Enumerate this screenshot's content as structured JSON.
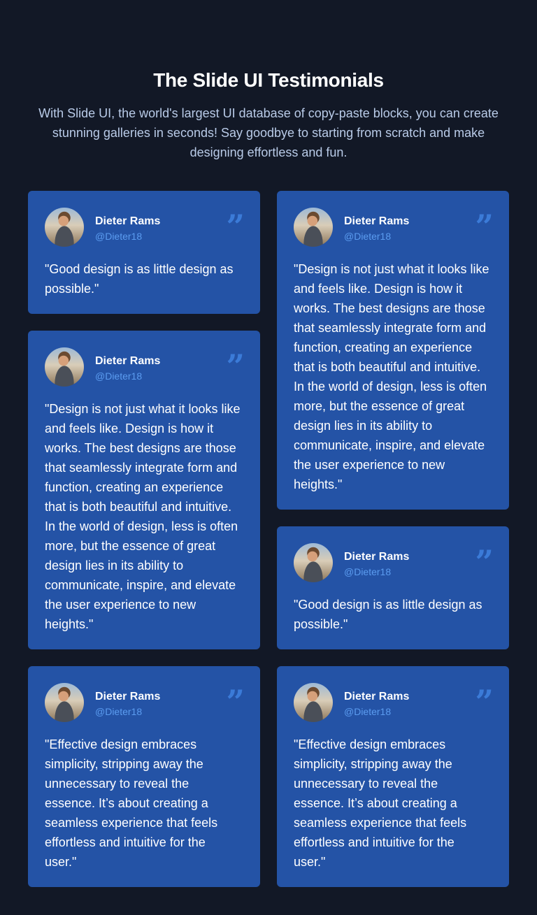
{
  "header": {
    "title": "The Slide UI Testimonials",
    "subtitle": "With Slide UI, the world's largest UI database of copy-paste blocks, you can create stunning galleries in seconds! Say goodbye to starting from scratch and make designing effortless and fun."
  },
  "testimonials": [
    {
      "name": "Dieter Rams",
      "handle": "@Dieter18",
      "quote": "\"Good design is as little design as possible.\""
    },
    {
      "name": "Dieter Rams",
      "handle": "@Dieter18",
      "quote": "\"Design is not just what it looks like and feels like. Design is how it works. The best designs are those that seamlessly integrate form and function, creating an experience that is both beautiful and intuitive. In the world of design, less is often more, but the essence of great design lies in its ability to communicate, inspire, and elevate the user experience to new heights.\""
    },
    {
      "name": "Dieter Rams",
      "handle": "@Dieter18",
      "quote": "\"Design is not just what it looks like and feels like. Design is how it works. The best designs are those that seamlessly integrate form and function, creating an experience that is both beautiful and intuitive. In the world of design, less is often more, but the essence of great design lies in its ability to communicate, inspire, and elevate the user experience to new heights.\""
    },
    {
      "name": "Dieter Rams",
      "handle": "@Dieter18",
      "quote": "\"Good design is as little design as possible.\""
    },
    {
      "name": "Dieter Rams",
      "handle": "@Dieter18",
      "quote": "\"Effective design embraces simplicity, stripping away the unnecessary to reveal the essence. It’s about creating a seamless experience that feels effortless and intuitive for the user.\""
    },
    {
      "name": "Dieter Rams",
      "handle": "@Dieter18",
      "quote": "\"Effective design embraces simplicity, stripping away the unnecessary to reveal the essence. It’s about creating a seamless experience that feels effortless and intuitive for the user.\""
    }
  ],
  "icons": {
    "quote_mark": "quote-icon",
    "avatar": "avatar"
  },
  "colors": {
    "background": "#121826",
    "card": "#2453a6",
    "handle": "#5b9cf0",
    "quote_icon": "#3b7bd8",
    "subtitle": "#b9cbe8"
  }
}
